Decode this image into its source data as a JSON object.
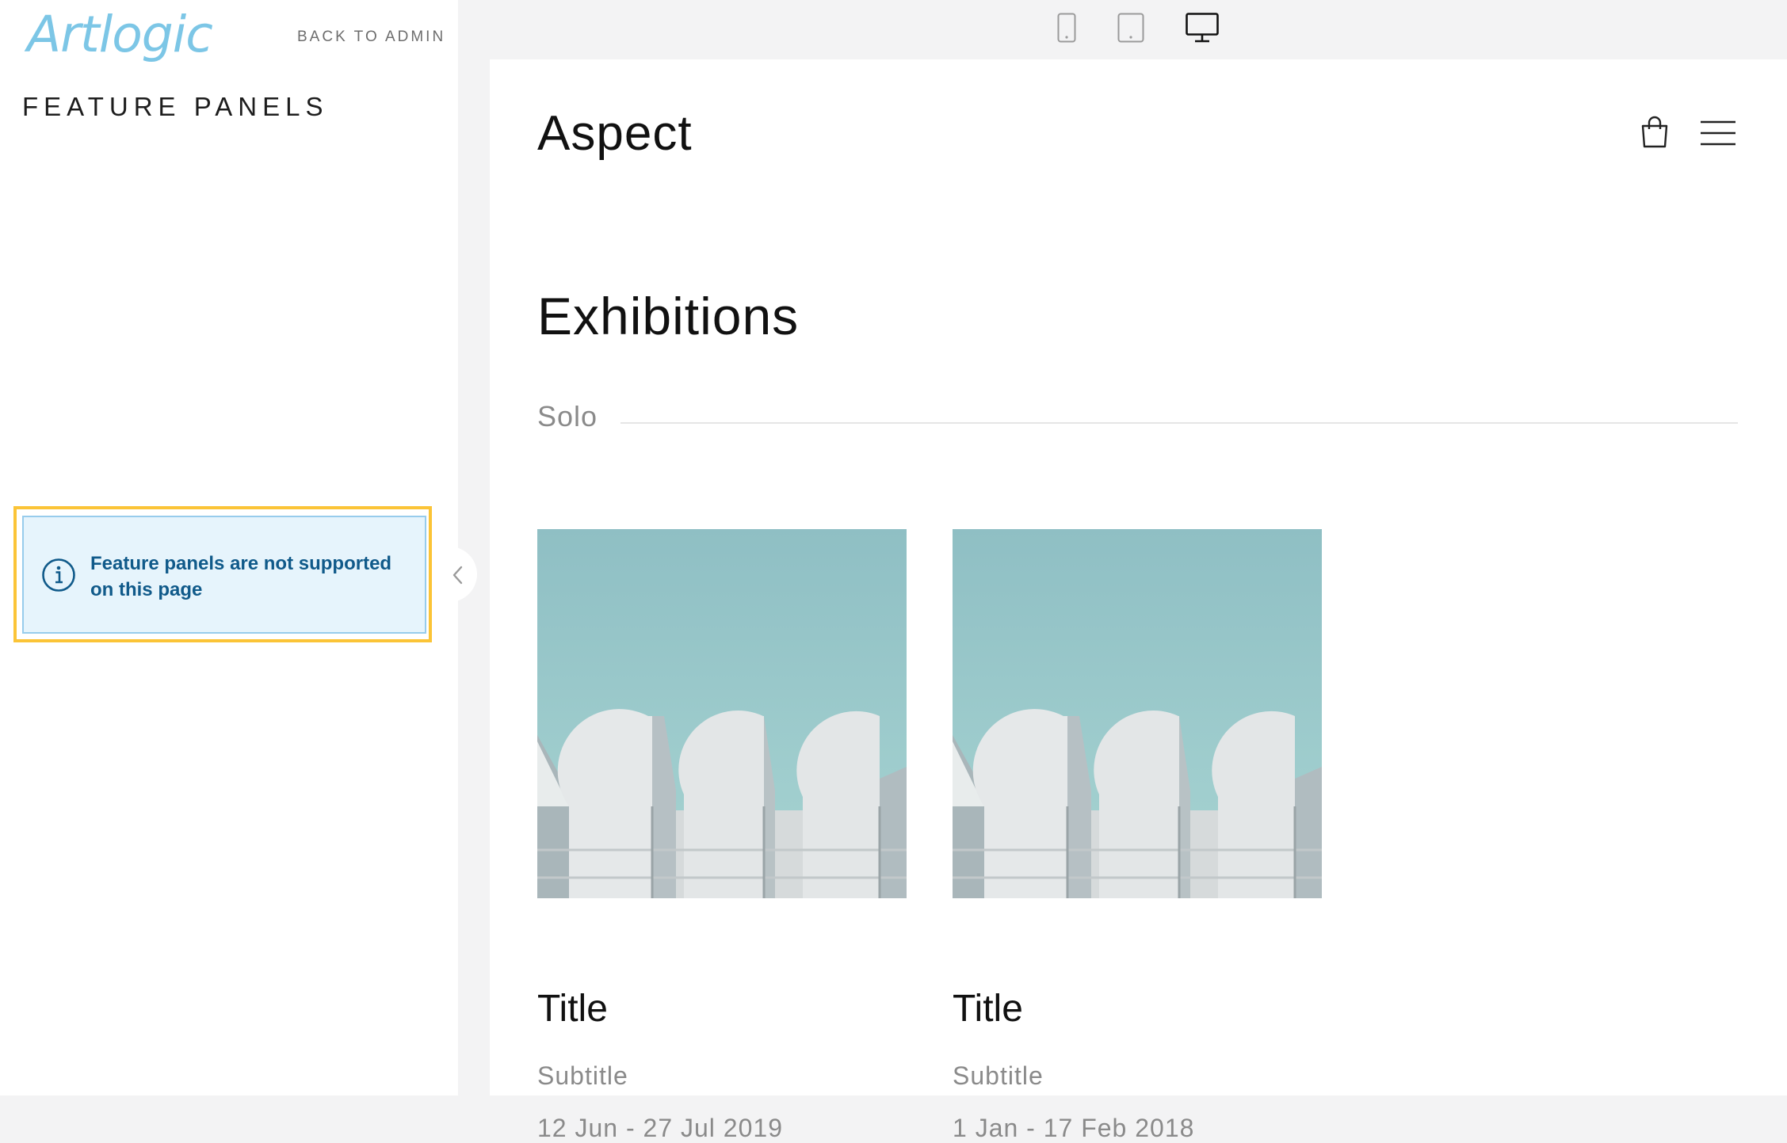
{
  "sidebar": {
    "logo_text": "Artlogic",
    "back_link": "BACK TO ADMIN",
    "heading": "FEATURE PANELS",
    "notice": {
      "text": "Feature panels are not supported on this page",
      "icon": "info-circle-icon"
    },
    "collapse_icon": "chevron-left-icon"
  },
  "device_toggle": {
    "options": [
      {
        "name": "mobile",
        "icon": "phone-icon",
        "active": false
      },
      {
        "name": "tablet",
        "icon": "tablet-icon",
        "active": false
      },
      {
        "name": "desktop",
        "icon": "desktop-monitor-icon",
        "active": true
      }
    ]
  },
  "preview": {
    "site_title": "Aspect",
    "header_icons": [
      "shopping-bag-icon",
      "hamburger-menu-icon"
    ],
    "page_heading": "Exhibitions",
    "section_label": "Solo",
    "cards": [
      {
        "title": "Title",
        "subtitle": "Subtitle",
        "dates": "12 Jun - 27 Jul 2019"
      },
      {
        "title": "Title",
        "subtitle": "Subtitle",
        "dates": "1 Jan - 17 Feb 2018"
      }
    ]
  },
  "colors": {
    "logo": "#7cc6e6",
    "highlight_border": "#fbc437",
    "notice_bg": "#e6f4fc",
    "notice_text": "#105a8a",
    "image_sky": "#9ccccd"
  }
}
